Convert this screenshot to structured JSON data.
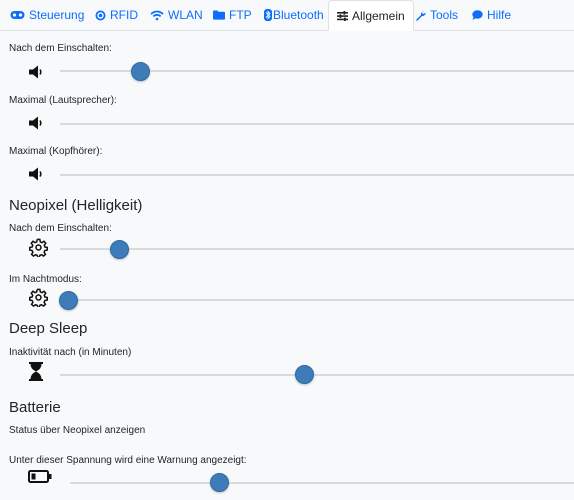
{
  "tabs": [
    {
      "label": "Steuerung",
      "icon": "gamepad-icon"
    },
    {
      "label": "RFID",
      "icon": "dot-circle-icon"
    },
    {
      "label": "WLAN",
      "icon": "wifi-icon"
    },
    {
      "label": "FTP",
      "icon": "folder-icon"
    },
    {
      "label": "Bluetooth",
      "icon": "bluetooth-icon"
    },
    {
      "label": "Allgemein",
      "icon": "sliders-icon",
      "active": true
    },
    {
      "label": "Tools",
      "icon": "wrench-icon"
    },
    {
      "label": "Hilfe",
      "icon": "comment-icon"
    }
  ],
  "volume": {
    "on_start": {
      "label": "Nach dem Einschalten:",
      "level": 0.14
    },
    "max_speaker": {
      "label": "Maximal (Lautsprecher):",
      "level": 0.0
    },
    "max_headphone": {
      "label": "Maximal (Kopfhörer):",
      "level": 0.0
    }
  },
  "neopixel": {
    "heading": "Neopixel (Helligkeit)",
    "on_start": {
      "label": "Nach dem Einschalten:",
      "level": 0.1
    },
    "night_mode": {
      "label": "Im Nachtmodus:",
      "level": 0.0
    }
  },
  "deep_sleep": {
    "heading": "Deep Sleep",
    "inactivity": {
      "label": "Inaktivität nach (in Minuten)",
      "level": 0.46
    }
  },
  "battery": {
    "heading": "Batterie",
    "status_label": "Status über Neopixel anzeigen",
    "warning": {
      "label": "Unter dieser Spannung wird eine Warnung angezeigt:",
      "level": 0.28
    }
  },
  "colors": {
    "link": "#0d6efd",
    "thumb": "#3d7cb8",
    "track": "#d8dbde"
  }
}
